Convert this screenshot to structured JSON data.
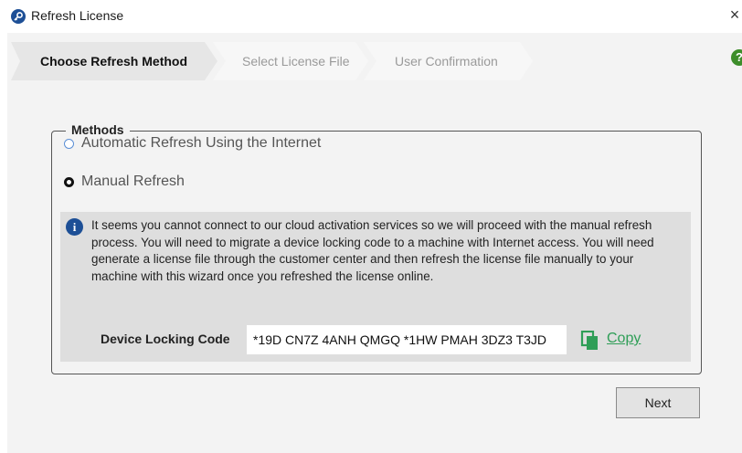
{
  "window": {
    "title": "Refresh License",
    "app_icon": "key-icon",
    "close_glyph": "×"
  },
  "wizard": {
    "steps": [
      {
        "label": "Choose Refresh Method",
        "state": "active"
      },
      {
        "label": "Select License File",
        "state": "inactive"
      },
      {
        "label": "User Confirmation",
        "state": "inactive"
      }
    ],
    "help_glyph": "?"
  },
  "methods": {
    "legend": "Methods",
    "options": [
      {
        "label": "Automatic Refresh Using the Internet",
        "selected": false
      },
      {
        "label": "Manual Refresh",
        "selected": true
      }
    ]
  },
  "info": {
    "icon_glyph": "i",
    "text": "It seems you cannot connect to our cloud activation services so we will proceed with the manual refresh process. You will need to migrate a device locking code to a machine with Internet access. You will need generate a license file through the customer center and then refresh the license file manually to your machine with this wizard once you refreshed the license online.",
    "device_locking_label": "Device Locking Code",
    "device_locking_code": "*19D CN7Z 4ANH QMGQ *1HW PMAH 3DZ3 T3JD",
    "copy_label": "Copy"
  },
  "footer": {
    "next_label": "Next"
  },
  "colors": {
    "accent_blue": "#1d4f96",
    "copy_green": "#2f9e57",
    "help_green": "#3d8d2a"
  }
}
